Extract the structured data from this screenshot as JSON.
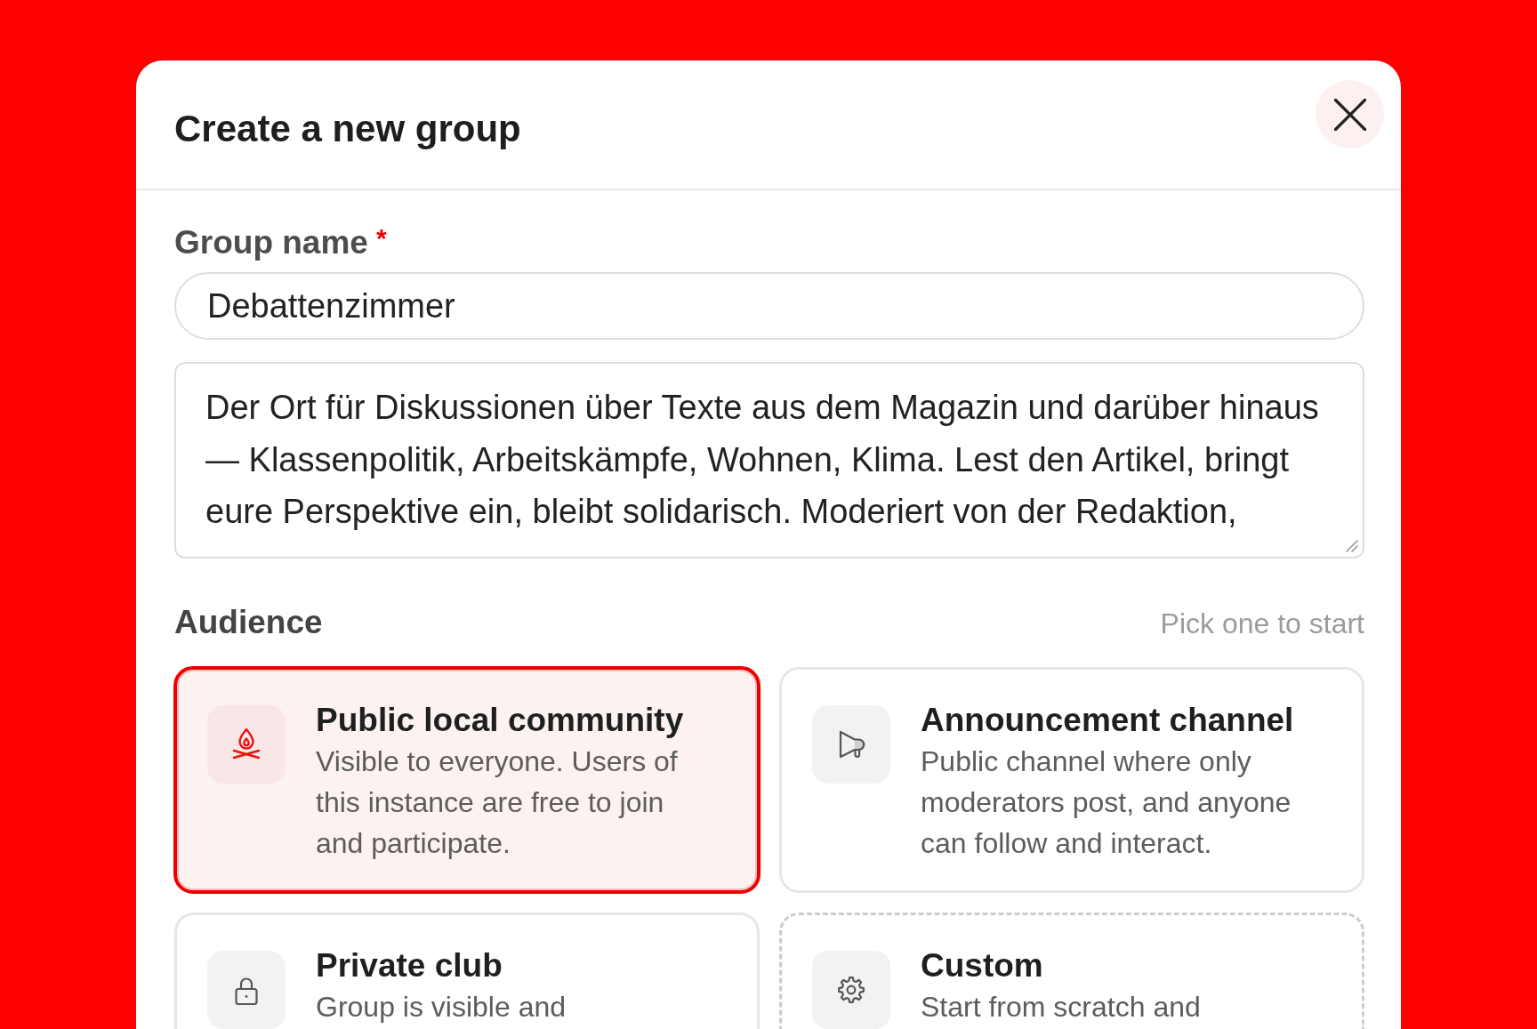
{
  "dialog": {
    "title": "Create a new group"
  },
  "group_name": {
    "label": "Group name",
    "required_mark": "*",
    "value": "Debattenzimmer"
  },
  "description": {
    "value": "Der Ort für Diskussionen über Texte aus dem Magazin und darüber hinaus — Klassenpolitik, Arbeitskämpfe, Wohnen, Klima. Lest den Artikel, bringt eure Perspektive ein, bleibt solidarisch. Moderiert von der Redaktion,"
  },
  "audience": {
    "heading": "Audience",
    "hint": "Pick one to start",
    "options": [
      {
        "kind": "preset",
        "title": "Public local community",
        "description": "Visible to everyone. Users of this instance are free to join and participate.",
        "selected": true
      },
      {
        "kind": "preset",
        "title": "Announcement channel",
        "description": "Public channel where only moderators post, and anyone can follow and interact.",
        "selected": false
      },
      {
        "kind": "preset",
        "title": "Private club",
        "description": "Group is visible and",
        "selected": false
      },
      {
        "kind": "custom",
        "title": "Custom",
        "description": "Start from scratch and",
        "selected": false
      }
    ]
  }
}
